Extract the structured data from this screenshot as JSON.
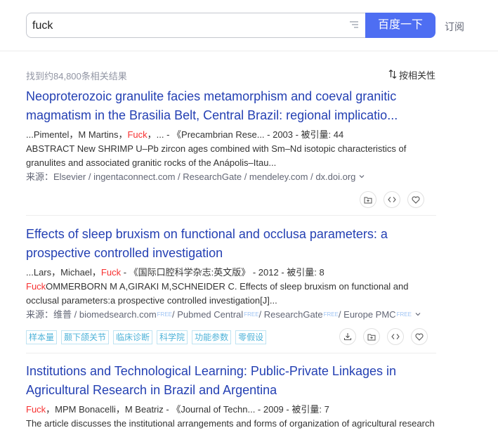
{
  "search": {
    "query": "fuck",
    "button_label": "百度一下",
    "subscribe_label": "订阅"
  },
  "summary": {
    "count_text": "找到约84,800条相关结果",
    "sort_label": "按相关性"
  },
  "results": [
    {
      "title_line1": "Neoproterozoic granulite facies metamorphism and coeval granitic",
      "title_line2": "magmatism in the Brasilia Belt, Central Brazil: regional implicatio...",
      "authors_pre": "...Pimentel，M Martins，",
      "authors_highlight": "Fuck",
      "authors_post": "，... - 《Precambrian Rese... - 2003 - 被引量: 44",
      "abstract_line1": "ABSTRACT New SHRIMP U–Pb zircon ages combined with Sm–Nd isotopic characteristics of",
      "abstract_line2": "granulites and associated granitic rocks of the Anápolis–Itau...",
      "source": "来源：Elsevier / ingentaconnect.com / ResearchGate / mendeley.com / dx.doi.org"
    },
    {
      "title_line1": "Effects of sleep bruxism on functional and occlusa parameters: a",
      "title_line2": "prospective controlled investigation",
      "authors_pre": "...Lars，Michael，",
      "authors_highlight": "Fuck",
      "authors_post": " - 《国际口腔科学杂志:英文版》 - 2012 - 被引量: 8",
      "abstract_highlight": "Fuck",
      "abstract_line1": "OMMERBORN M A,GIRAKI M,SCHNEIDER C. Effects of sleep bruxism on functional and",
      "abstract_line2": "occlusal parameters:a prospective controlled investigation[J]...",
      "source_prefix": "来源：维普 / biomedsearch.com",
      "source_parts": [
        " / Pubmed Central",
        " / ResearchGate",
        " / Europe PMC"
      ],
      "free_label": "FREE",
      "tags": [
        "样本量",
        "颞下颌关节",
        "临床诊断",
        "科学院",
        "功能参数",
        "零假设"
      ]
    },
    {
      "title_line1": "Institutions and Technological Learning: Public-Private Linkages in",
      "title_line2": "Agricultural Research in Brazil and Argentina",
      "authors_highlight": "Fuck",
      "authors_post": "，MPM Bonacelli，M Beatriz - 《Journal of Techn... - 2009 - 被引量: 7",
      "abstract_line1": "The article discusses the institutional arrangements and forms of organization of agricultural research"
    }
  ],
  "icons": {
    "filter": "filter-lines-icon",
    "sort": "sort-arrows-icon",
    "collect": "folder-add-icon",
    "cite": "code-brackets-icon",
    "favorite": "heart-icon",
    "download": "download-icon",
    "chevron": "chevron-down-icon"
  },
  "colors": {
    "accent": "#4e6ef2",
    "link": "#2440b3",
    "highlight": "#f73131",
    "tag": "#4fb3d9"
  }
}
